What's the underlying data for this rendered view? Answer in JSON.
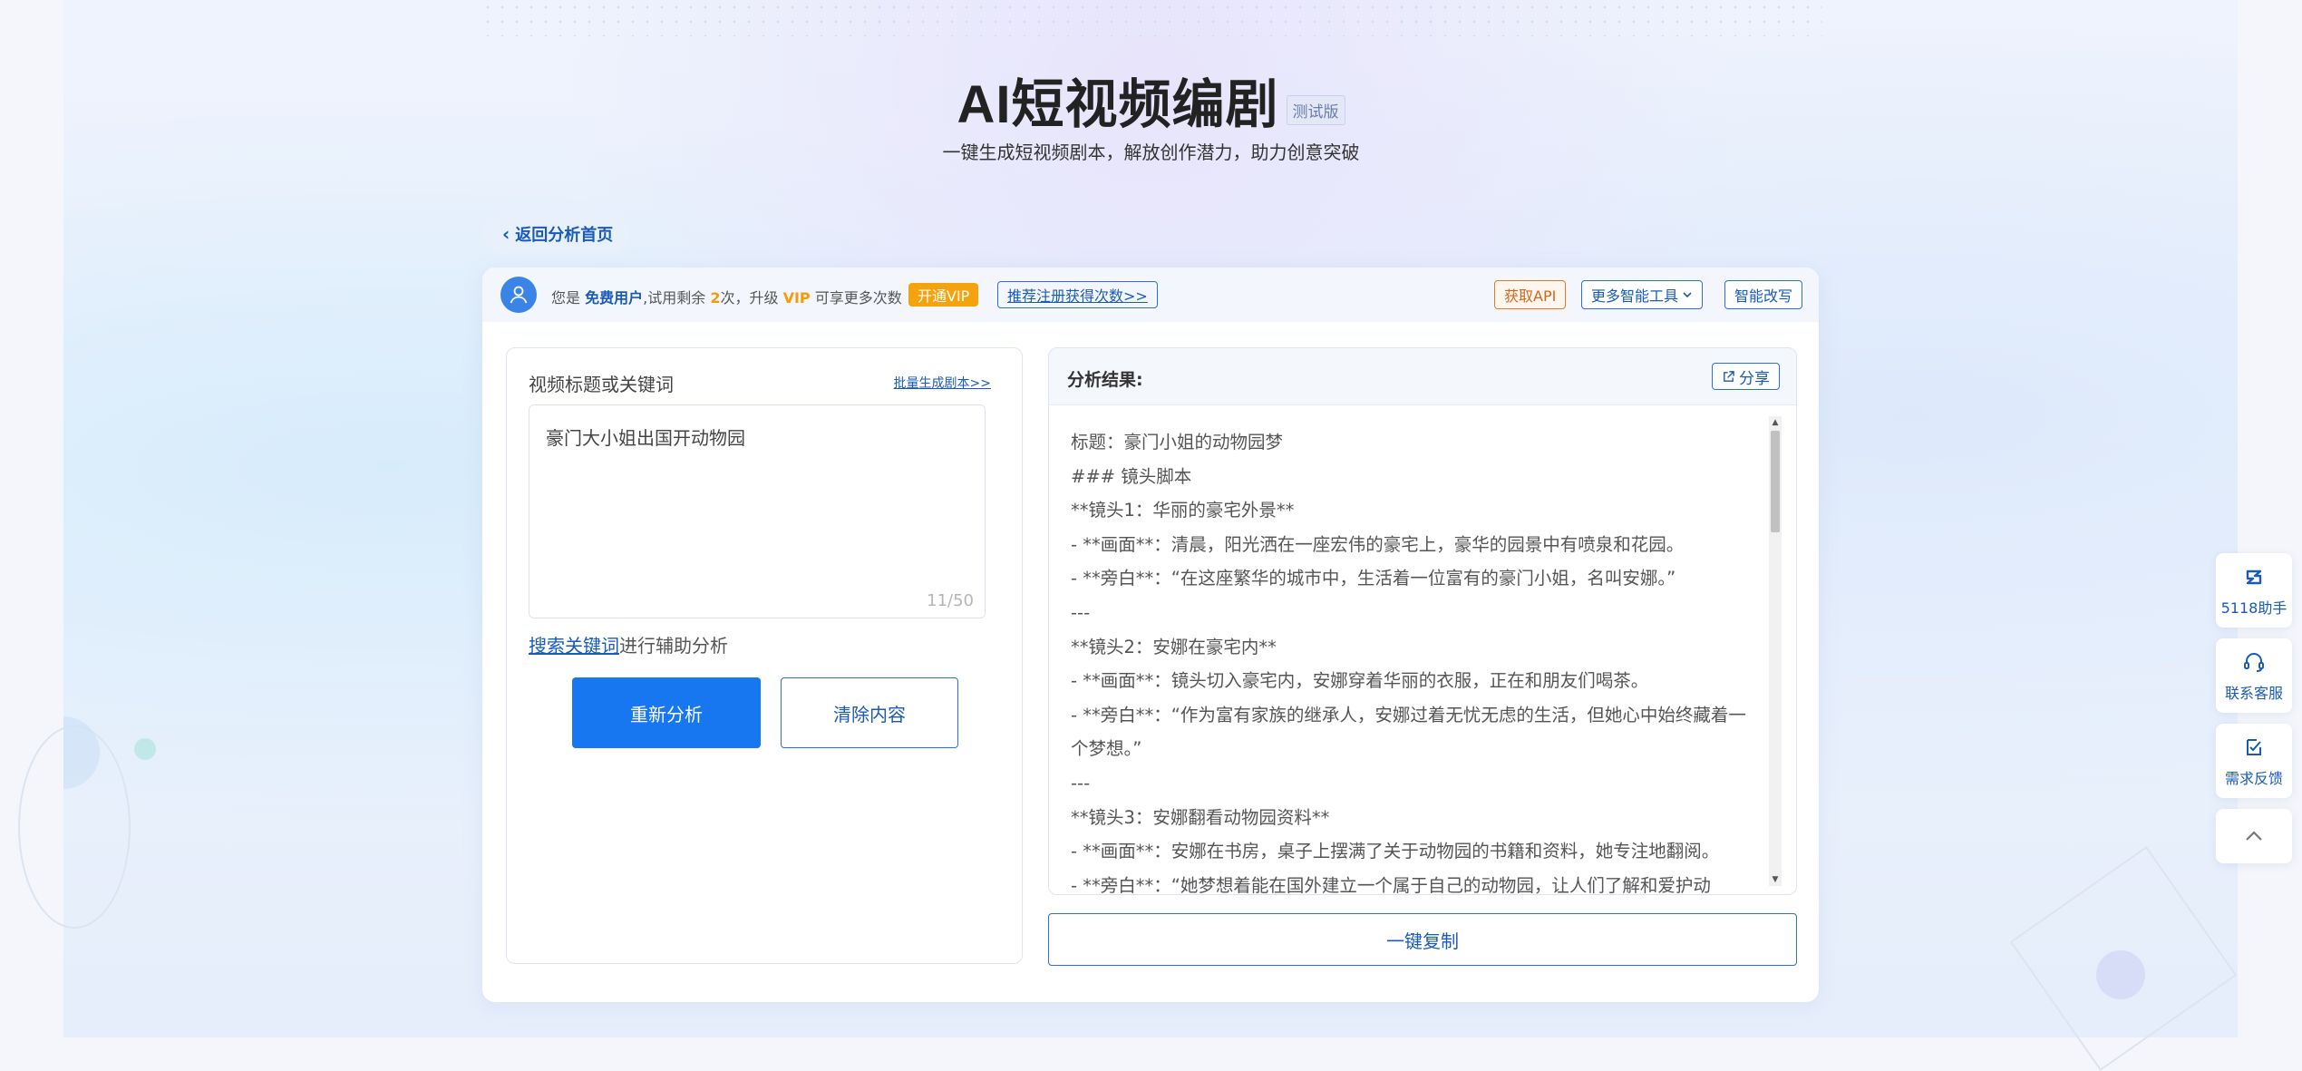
{
  "header": {
    "title": "AI短视频编剧",
    "beta_badge": "测试版",
    "subtitle": "一键生成短视频剧本，解放创作潜力，助力创意突破"
  },
  "back_button": "返回分析首页",
  "topbar": {
    "prefix": "您是",
    "user_type": "免费用户",
    "trial_text": ",试用剩余",
    "remaining": "2",
    "times_upgrade": "次，升级",
    "vip": "VIP",
    "more_times": "可享更多次数",
    "open_vip": "开通VIP",
    "invite": "推荐注册获得次数>>",
    "get_api": "获取API",
    "more_tools": "更多智能工具",
    "smart_rewrite": "智能改写"
  },
  "left": {
    "field_label": "视频标题或关键词",
    "batch_link": "批量生成剧本>>",
    "input_value": "豪门大小姐出国开动物园",
    "counter": "11/50",
    "search_link": "搜索关键词",
    "search_suffix": "进行辅助分析",
    "reanalyze": "重新分析",
    "clear": "清除内容"
  },
  "right": {
    "result_label": "分析结果:",
    "share": "分享",
    "lines": [
      "标题：豪门小姐的动物园梦",
      "### 镜头脚本",
      "**镜头1：华丽的豪宅外景**",
      "- **画面**：清晨，阳光洒在一座宏伟的豪宅上，豪华的园景中有喷泉和花园。",
      "- **旁白**：“在这座繁华的城市中，生活着一位富有的豪门小姐，名叫安娜。”",
      "---",
      "**镜头2：安娜在豪宅内**",
      "- **画面**：镜头切入豪宅内，安娜穿着华丽的衣服，正在和朋友们喝茶。",
      "- **旁白**：“作为富有家族的继承人，安娜过着无忧无虑的生活，但她心中始终藏着一个梦想。”",
      "---",
      "**镜头3：安娜翻看动物园资料**",
      "- **画面**：安娜在书房，桌子上摆满了关于动物园的书籍和资料，她专注地翻阅。",
      "- **旁白**：“她梦想着能在国外建立一个属于自己的动物园，让人们了解和爱护动"
    ],
    "copy": "一键复制"
  },
  "side_tools": [
    {
      "label": "5118助手",
      "icon": "brand-5118-icon"
    },
    {
      "label": "联系客服",
      "icon": "headset-icon"
    },
    {
      "label": "需求反馈",
      "icon": "feedback-icon"
    }
  ],
  "colors": {
    "primary": "#1677f0",
    "link": "#1a5bb8",
    "vip": "#f5a20f",
    "api": "#d9641a"
  }
}
